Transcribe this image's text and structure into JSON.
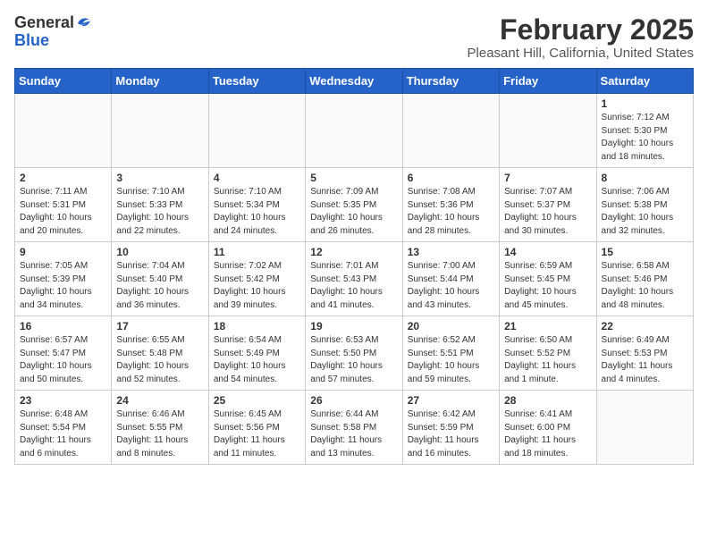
{
  "header": {
    "logo_general": "General",
    "logo_blue": "Blue",
    "month": "February 2025",
    "location": "Pleasant Hill, California, United States"
  },
  "weekdays": [
    "Sunday",
    "Monday",
    "Tuesday",
    "Wednesday",
    "Thursday",
    "Friday",
    "Saturday"
  ],
  "weeks": [
    [
      {
        "day": "",
        "info": ""
      },
      {
        "day": "",
        "info": ""
      },
      {
        "day": "",
        "info": ""
      },
      {
        "day": "",
        "info": ""
      },
      {
        "day": "",
        "info": ""
      },
      {
        "day": "",
        "info": ""
      },
      {
        "day": "1",
        "info": "Sunrise: 7:12 AM\nSunset: 5:30 PM\nDaylight: 10 hours\nand 18 minutes."
      }
    ],
    [
      {
        "day": "2",
        "info": "Sunrise: 7:11 AM\nSunset: 5:31 PM\nDaylight: 10 hours\nand 20 minutes."
      },
      {
        "day": "3",
        "info": "Sunrise: 7:10 AM\nSunset: 5:33 PM\nDaylight: 10 hours\nand 22 minutes."
      },
      {
        "day": "4",
        "info": "Sunrise: 7:10 AM\nSunset: 5:34 PM\nDaylight: 10 hours\nand 24 minutes."
      },
      {
        "day": "5",
        "info": "Sunrise: 7:09 AM\nSunset: 5:35 PM\nDaylight: 10 hours\nand 26 minutes."
      },
      {
        "day": "6",
        "info": "Sunrise: 7:08 AM\nSunset: 5:36 PM\nDaylight: 10 hours\nand 28 minutes."
      },
      {
        "day": "7",
        "info": "Sunrise: 7:07 AM\nSunset: 5:37 PM\nDaylight: 10 hours\nand 30 minutes."
      },
      {
        "day": "8",
        "info": "Sunrise: 7:06 AM\nSunset: 5:38 PM\nDaylight: 10 hours\nand 32 minutes."
      }
    ],
    [
      {
        "day": "9",
        "info": "Sunrise: 7:05 AM\nSunset: 5:39 PM\nDaylight: 10 hours\nand 34 minutes."
      },
      {
        "day": "10",
        "info": "Sunrise: 7:04 AM\nSunset: 5:40 PM\nDaylight: 10 hours\nand 36 minutes."
      },
      {
        "day": "11",
        "info": "Sunrise: 7:02 AM\nSunset: 5:42 PM\nDaylight: 10 hours\nand 39 minutes."
      },
      {
        "day": "12",
        "info": "Sunrise: 7:01 AM\nSunset: 5:43 PM\nDaylight: 10 hours\nand 41 minutes."
      },
      {
        "day": "13",
        "info": "Sunrise: 7:00 AM\nSunset: 5:44 PM\nDaylight: 10 hours\nand 43 minutes."
      },
      {
        "day": "14",
        "info": "Sunrise: 6:59 AM\nSunset: 5:45 PM\nDaylight: 10 hours\nand 45 minutes."
      },
      {
        "day": "15",
        "info": "Sunrise: 6:58 AM\nSunset: 5:46 PM\nDaylight: 10 hours\nand 48 minutes."
      }
    ],
    [
      {
        "day": "16",
        "info": "Sunrise: 6:57 AM\nSunset: 5:47 PM\nDaylight: 10 hours\nand 50 minutes."
      },
      {
        "day": "17",
        "info": "Sunrise: 6:55 AM\nSunset: 5:48 PM\nDaylight: 10 hours\nand 52 minutes."
      },
      {
        "day": "18",
        "info": "Sunrise: 6:54 AM\nSunset: 5:49 PM\nDaylight: 10 hours\nand 54 minutes."
      },
      {
        "day": "19",
        "info": "Sunrise: 6:53 AM\nSunset: 5:50 PM\nDaylight: 10 hours\nand 57 minutes."
      },
      {
        "day": "20",
        "info": "Sunrise: 6:52 AM\nSunset: 5:51 PM\nDaylight: 10 hours\nand 59 minutes."
      },
      {
        "day": "21",
        "info": "Sunrise: 6:50 AM\nSunset: 5:52 PM\nDaylight: 11 hours\nand 1 minute."
      },
      {
        "day": "22",
        "info": "Sunrise: 6:49 AM\nSunset: 5:53 PM\nDaylight: 11 hours\nand 4 minutes."
      }
    ],
    [
      {
        "day": "23",
        "info": "Sunrise: 6:48 AM\nSunset: 5:54 PM\nDaylight: 11 hours\nand 6 minutes."
      },
      {
        "day": "24",
        "info": "Sunrise: 6:46 AM\nSunset: 5:55 PM\nDaylight: 11 hours\nand 8 minutes."
      },
      {
        "day": "25",
        "info": "Sunrise: 6:45 AM\nSunset: 5:56 PM\nDaylight: 11 hours\nand 11 minutes."
      },
      {
        "day": "26",
        "info": "Sunrise: 6:44 AM\nSunset: 5:58 PM\nDaylight: 11 hours\nand 13 minutes."
      },
      {
        "day": "27",
        "info": "Sunrise: 6:42 AM\nSunset: 5:59 PM\nDaylight: 11 hours\nand 16 minutes."
      },
      {
        "day": "28",
        "info": "Sunrise: 6:41 AM\nSunset: 6:00 PM\nDaylight: 11 hours\nand 18 minutes."
      },
      {
        "day": "",
        "info": ""
      }
    ]
  ]
}
